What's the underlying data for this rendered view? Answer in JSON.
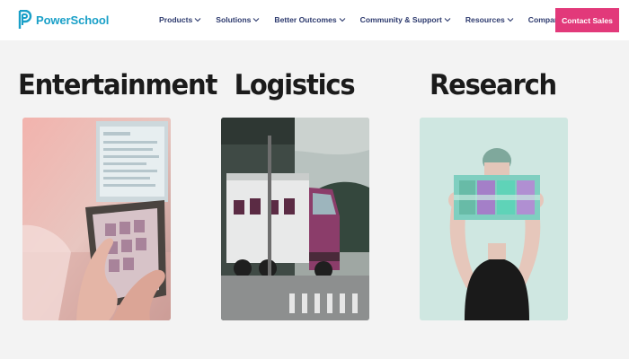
{
  "brand": {
    "name": "PowerSchool"
  },
  "nav": [
    {
      "label": "Products"
    },
    {
      "label": "Solutions"
    },
    {
      "label": "Better Outcomes"
    },
    {
      "label": "Community & Support"
    },
    {
      "label": "Resources"
    },
    {
      "label": "Company"
    }
  ],
  "cta": {
    "label": "Contact Sales"
  },
  "categories": [
    {
      "title": "Entertainment"
    },
    {
      "title": "Logistics"
    },
    {
      "title": "Research"
    }
  ],
  "colors": {
    "brand": "#1aa0c8",
    "nav_text": "#2d3a6e",
    "cta": "#e2397a",
    "background": "#f3f3f3"
  },
  "icons": [
    "powerschool-logo-icon",
    "chevron-down-icon"
  ]
}
